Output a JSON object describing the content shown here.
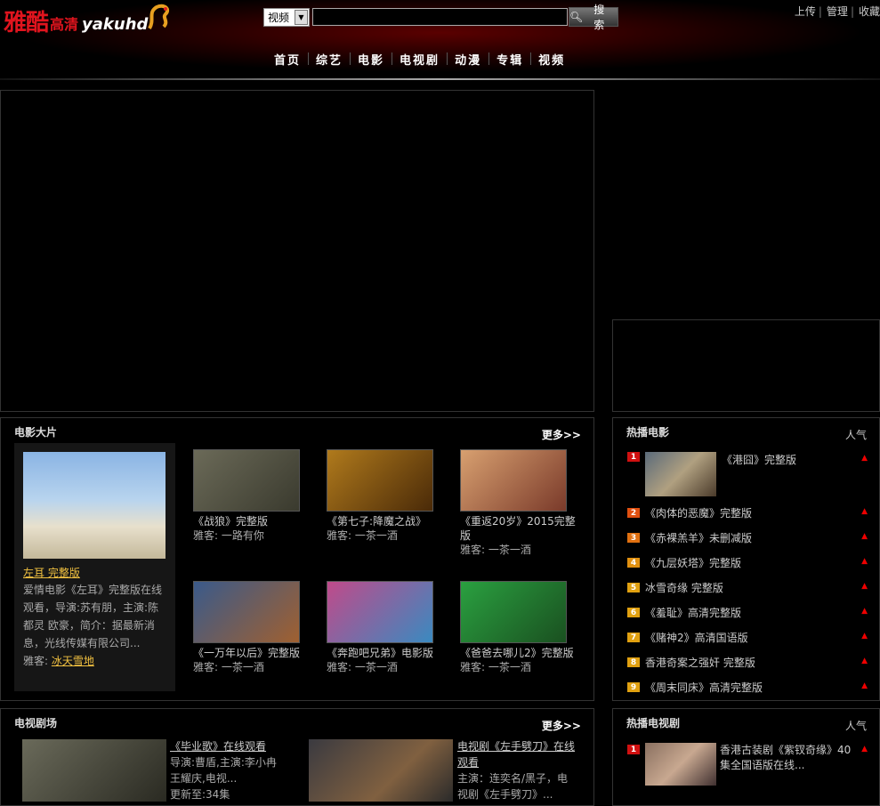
{
  "header": {
    "logo_cn": "雅酷",
    "logo_cn2": "高清",
    "logo_en": "yakuhd",
    "search_type": "视频",
    "search_value": "",
    "search_button": "搜索",
    "links": [
      "上传",
      "管理",
      "收藏"
    ]
  },
  "nav": [
    "首页",
    "综艺",
    "电影",
    "电视剧",
    "动漫",
    "专辑",
    "视频"
  ],
  "movies_box": {
    "title": "电影大片",
    "more": "更多>>",
    "feature": {
      "title": "左耳  完整版",
      "desc": "爱情电影《左耳》完整版在线观看，导演:苏有朋，主演:陈都灵 欧豪，简介：据最新消息，光线传媒有限公司...",
      "uploader_label": "雅客: ",
      "uploader": "冰天雪地"
    },
    "items": [
      {
        "title": "《战狼》完整版",
        "uploader": "雅客: 一路有你",
        "c1": "#6b6a58",
        "c2": "#3a3a2e"
      },
      {
        "title": "《第七子:降魔之战》",
        "uploader": "雅客: 一茶一酒",
        "c1": "#b07a1c",
        "c2": "#4a2a08"
      },
      {
        "title": "《重返20岁》2015完整版",
        "uploader": "雅客: 一茶一酒",
        "c1": "#d8a070",
        "c2": "#7a3a2a"
      },
      {
        "title": "《一万年以后》完整版",
        "uploader": "雅客: 一茶一酒",
        "c1": "#3a5a8a",
        "c2": "#a06030"
      },
      {
        "title": "《奔跑吧兄弟》电影版",
        "uploader": "雅客: 一茶一酒",
        "c1": "#c04a8a",
        "c2": "#3a8ac0"
      },
      {
        "title": "《爸爸去哪儿2》完整版",
        "uploader": "雅客: 一茶一酒",
        "c1": "#2aa040",
        "c2": "#1a5020"
      }
    ]
  },
  "hot_movies": {
    "title": "热播电影",
    "pop": "人气",
    "items": [
      "《港囧》完整版",
      "《肉体的恶魔》完整版",
      "《赤裸羔羊》未删减版",
      "《九层妖塔》完整版",
      "冰雪奇缘  完整版",
      "《羞耻》高清完整版",
      "《赌神2》高清国语版",
      "香港奇案之强奸  完整版",
      "《周末同床》高清完整版"
    ],
    "colors": [
      "#d01010",
      "#e05010",
      "#e07010",
      "#e09010",
      "#e0a010",
      "#e0a010",
      "#e0a010",
      "#e0a010",
      "#e0a010"
    ]
  },
  "tv_box": {
    "title": "电视剧场",
    "more": "更多>>",
    "items": [
      {
        "title": "《毕业歌》在线观看",
        "desc": "导演:曹盾,主演:李小冉 王耀庆,电视...",
        "extra": "更新至:34集"
      },
      {
        "title": "电视剧《左手劈刀》在线观看",
        "desc": "主演：连奕名/黑子，电视剧《左手劈刀》...",
        "extra": ""
      }
    ]
  },
  "hot_tv": {
    "title": "热播电视剧",
    "pop": "人气",
    "items": [
      {
        "num": "1",
        "title": "香港古装剧《紫钗奇缘》40集全国语版在线..."
      }
    ]
  }
}
